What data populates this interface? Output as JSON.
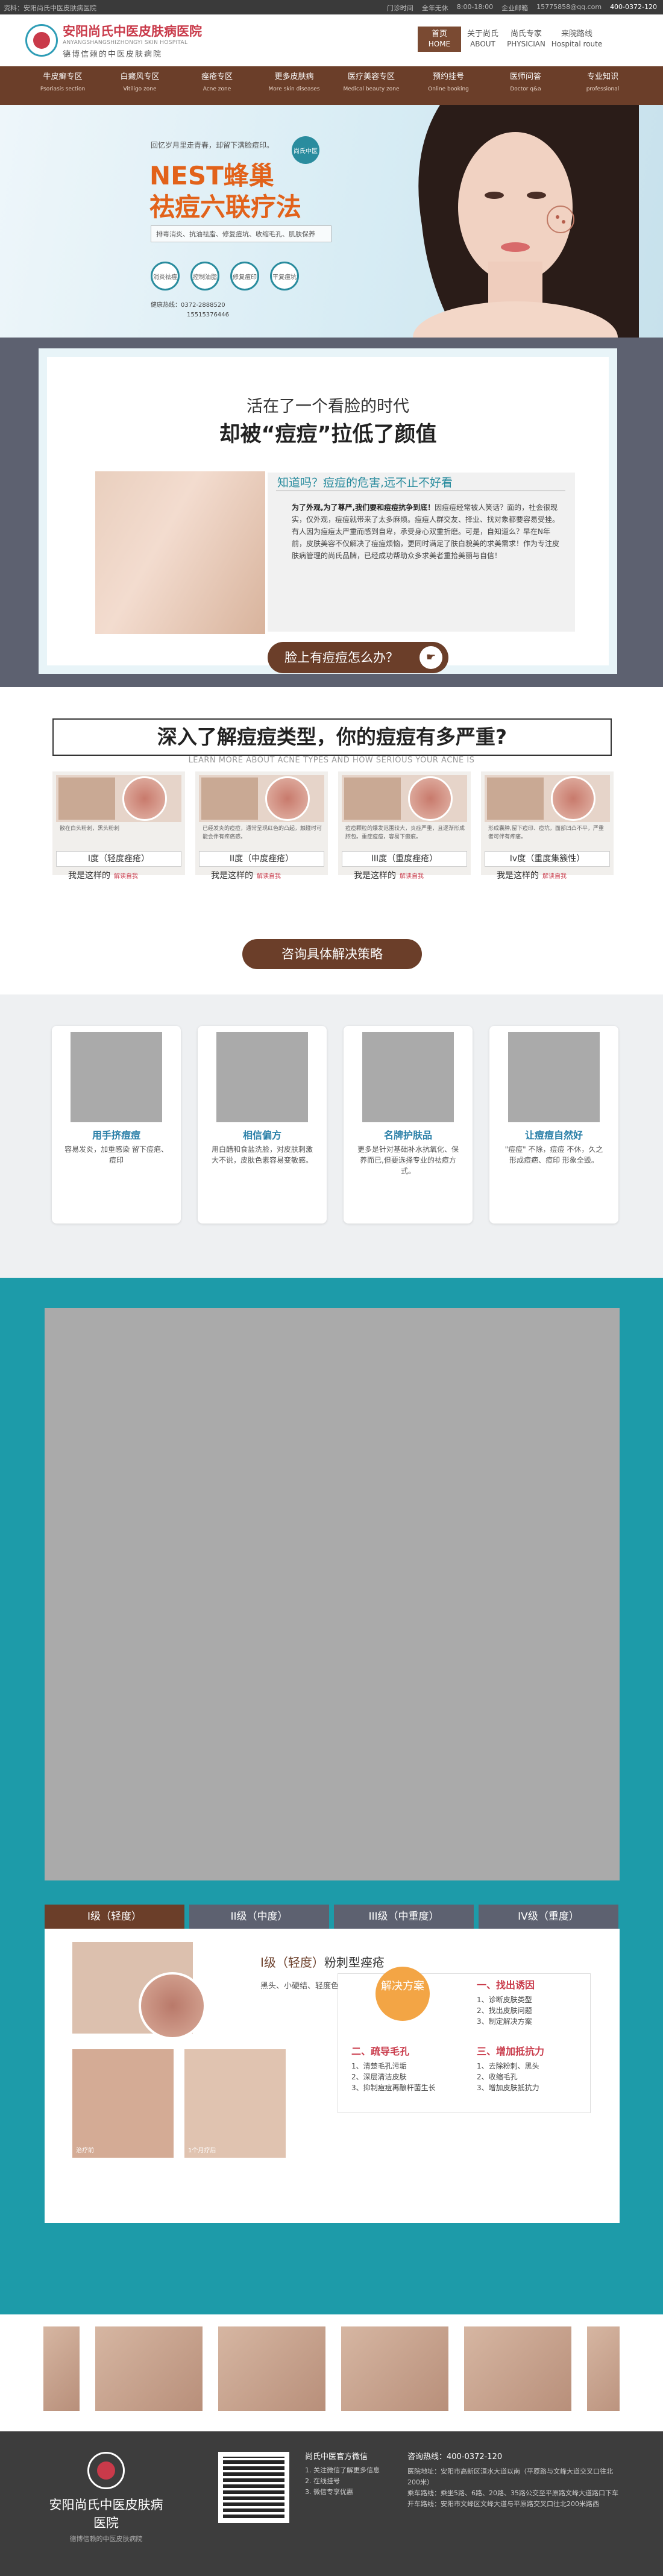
{
  "topbar": {
    "notice": "资料：安阳尚氏中医皮肤病医院",
    "links": [
      "门诊时间",
      "全年无休",
      "8:00-18:00",
      "企业邮箱",
      "15775858@qq.com"
    ],
    "phone": "400-0372-120"
  },
  "logo": {
    "name": "安阳尚氏中医皮肤病医院",
    "en": "ANYANGSHANGSHIZHONGYI SKIN HOSPITAL",
    "slogan": "德博信赖的中医皮肤病院"
  },
  "topnav": [
    {
      "cn": "首页",
      "en": "HOME"
    },
    {
      "cn": "关于尚氏",
      "en": "ABOUT"
    },
    {
      "cn": "尚氏专家",
      "en": "PHYSICIAN"
    },
    {
      "cn": "来院路线",
      "en": "Hospital route"
    }
  ],
  "mainnav": [
    {
      "cn": "牛皮癣专区",
      "en": "Psoriasis section"
    },
    {
      "cn": "白癜风专区",
      "en": "Vitiligo zone"
    },
    {
      "cn": "痤疮专区",
      "en": "Acne zone"
    },
    {
      "cn": "更多皮肤病",
      "en": "More skin diseases"
    },
    {
      "cn": "医疗美容专区",
      "en": "Medical beauty zone"
    },
    {
      "cn": "预约挂号",
      "en": "Online booking"
    },
    {
      "cn": "医师问答",
      "en": "Doctor q&a"
    },
    {
      "cn": "专业知识",
      "en": "professional"
    }
  ],
  "banner": {
    "subtitle": "回忆岁月里走青春，却留下满脸痘印。",
    "badge": "尚氏中医",
    "title1": "NEST蜂巢",
    "title2": "祛痘六联疗法",
    "tags": "排毒消炎、抗油祛脂、修复痘坑、收缩毛孔、肌肤保养",
    "circles": [
      "消炎祛痘",
      "控制油脂",
      "修复痘印",
      "平复痘坑"
    ],
    "tel_label": "健康热线：",
    "tel1": "0372-2888520",
    "tel2": "15515376446"
  },
  "sec1": {
    "title1": "活在了一个看脸的时代",
    "title2": "却被“痘痘”拉低了颜值",
    "question": "知道吗？痘痘的危害,远不止不好看",
    "para_bold": "为了外观,为了尊严,我们要和痘痘抗争到底！",
    "para": "因痘痘经常被人笑话？面的，社会很现实，仅外观，痘痘就带来了太多麻烦。痘痘人群交友、择业、找对象都要容易受挫。有人因为痘痘太严重而感到自卑，承受身心双重折磨。可是，自知道么？早在N年前，皮肤美容不仅解决了痘痘烦恼，更同时满足了肤白貌美的求美需求！作为专注皮肤病管理的尚氏品牌，已经成功帮助众多求美者重拾美丽与自信！",
    "button": "脸上有痘痘怎么办？"
  },
  "sec2": {
    "title": "深入了解痘痘类型，你的痘痘有多严重?",
    "en": "LEARN MORE ABOUT ACNE TYPES AND HOW SERIOUS YOUR ACNE IS",
    "cards": [
      {
        "desc": "散在白头粉刺，黑头粉刺",
        "level": "I度（轻度痤疮）",
        "me": "我是这样的",
        "link": "解读自我"
      },
      {
        "desc": "已经发炎的痘痘，通常呈现红色的凸起，触碰时可能会伴有疼痛感。",
        "level": "II度（中度痤疮）",
        "me": "我是这样的",
        "link": "解读自我"
      },
      {
        "desc": "痘痘颗粒的爆发范围较大，炎症严重，且逐渐形成脓包。重症痘痘，容易下瘢痕。",
        "level": "III度（重度痤疮）",
        "me": "我是这样的",
        "link": "解读自我"
      },
      {
        "desc": "形成囊肿,留下痘印、痘坑，面部凹凸不平，严重者可伴有疼痛。",
        "level": "Iv度（重度集簇性）",
        "me": "我是这样的",
        "link": "解读自我"
      }
    ],
    "button": "咨询具体解决策略"
  },
  "sec3": {
    "cards": [
      {
        "title": "用手挤痘痘",
        "desc": "容易发炎，加重感染 留下痘疤、痘印"
      },
      {
        "title": "相信偏方",
        "desc": "用白醋和食盐洗脸，对皮肤刺激大不说，皮肤色素容易变敏感。"
      },
      {
        "title": "名牌护肤品",
        "desc": "更多是针对基础补水抗氧化、保养而已,但要选择专业的祛痘方式。"
      },
      {
        "title": "让痘痘自然好",
        "desc": "\"痘痘\" 不除，痘痘 不休，久之形成痘疤、痘印 形象全毁。"
      }
    ]
  },
  "sec4": {
    "tabs": [
      "I级（轻度）",
      "II级（中度）",
      "III级（中重度）",
      "IV级（重度）"
    ],
    "panel": {
      "title_prefix": "I级（轻度）",
      "title_main": "粉刺型痤疮",
      "tags": "黑头、小硬结、轻度色沉、黑头",
      "cap1": "治疗前",
      "cap2": "1个月疗后",
      "badge": "解决方案",
      "blocks": [
        {
          "head": "一、找出诱因",
          "items": [
            "1、诊断皮肤类型",
            "2、找出皮肤问题",
            "3、制定解决方案"
          ]
        },
        {
          "head": "二、疏导毛孔",
          "items": [
            "1、清楚毛孔污垢",
            "2、深层清洁皮肤",
            "3、抑制痘痘再酿杆菌生长"
          ]
        },
        {
          "head": "三、增加抵抗力",
          "items": [
            "1、去除粉刺、黑头",
            "2、收缩毛孔",
            "3、增加皮肤抵抗力"
          ]
        }
      ]
    }
  },
  "sec5": {
    "captions": [
      "",
      "",
      "",
      "",
      "",
      "",
      "",
      "",
      ""
    ]
  },
  "footer": {
    "name": "安阳尚氏中医皮肤病医院",
    "slogan": "德博信赖的中医皮肤病院",
    "wechat_title": "尚氏中医官方微信",
    "wechat_items": [
      "1. 关注微信了解更多信息",
      "2. 在线挂号",
      "3. 微信专享优惠"
    ],
    "tel": "咨询热线：400-0372-120",
    "lines": [
      "医院地址：安阳市高新区洹水大道以南（平原路与文峰大道交叉口往北200米）",
      "乘车路线：乘坐5路、6路、20路、35路公交至平原路文峰大道路口下车",
      "开车路线：安阳市文峰区文峰大道与平原路交叉口往北200米路西"
    ]
  }
}
